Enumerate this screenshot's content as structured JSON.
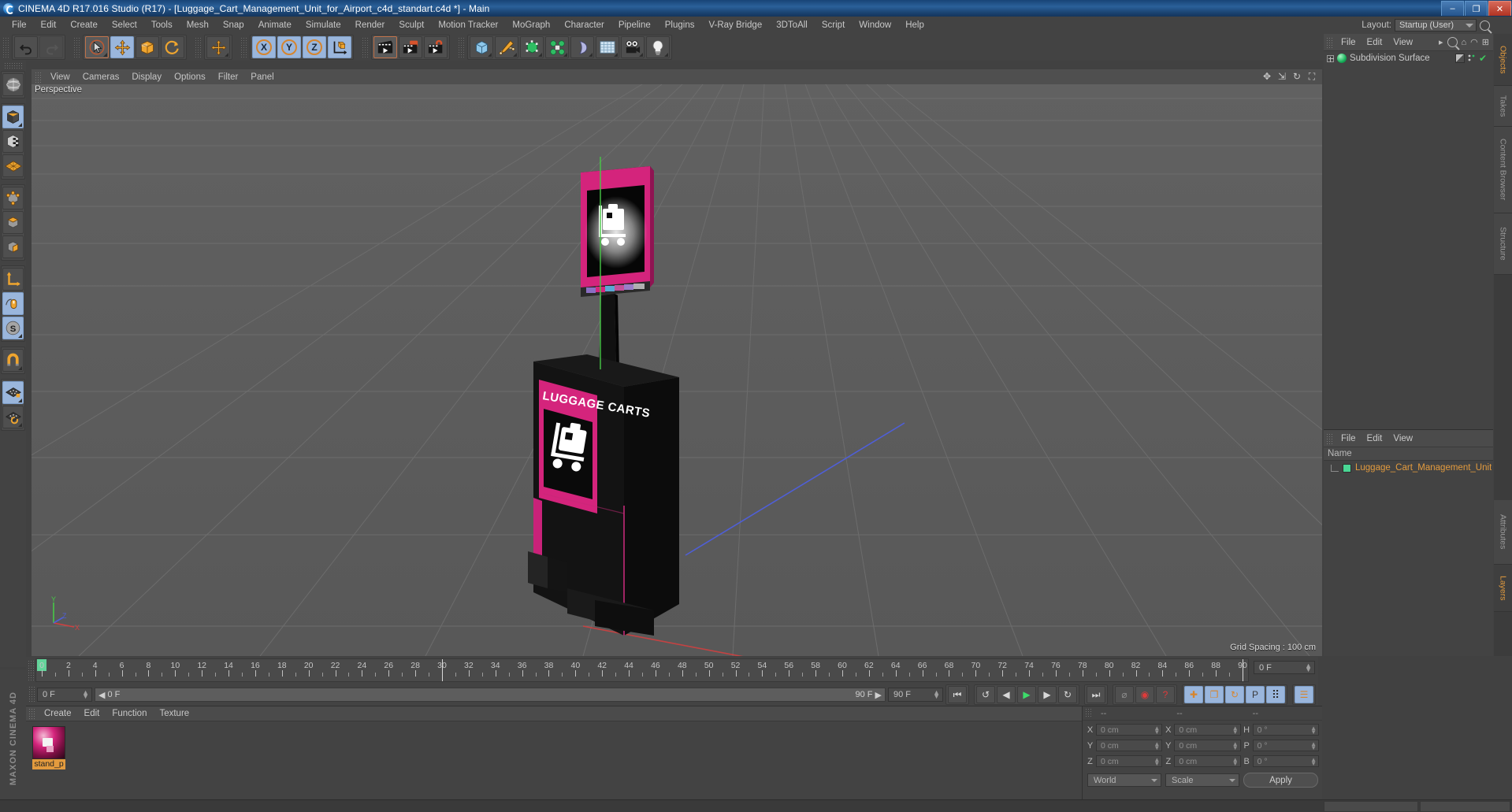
{
  "window": {
    "title": "CINEMA 4D R17.016 Studio (R17) - [Luggage_Cart_Management_Unit_for_Airport_c4d_standart.c4d *] - Main",
    "app_icon": "c4d-logo-icon",
    "minimize": "–",
    "maximize": "❐",
    "close": "✕"
  },
  "menubar": {
    "items": [
      "File",
      "Edit",
      "Create",
      "Select",
      "Tools",
      "Mesh",
      "Snap",
      "Animate",
      "Simulate",
      "Render",
      "Sculpt",
      "Motion Tracker",
      "MoGraph",
      "Character",
      "Pipeline",
      "Plugins",
      "V-Ray Bridge",
      "3DToAll",
      "Script",
      "Window",
      "Help"
    ],
    "layout_label": "Layout:",
    "layout_value": "Startup (User)",
    "search_icon": "search-icon"
  },
  "toolbar": {
    "groups": [
      {
        "name": "history",
        "buttons": [
          {
            "name": "undo-button",
            "glyph": "↶",
            "state": "normal"
          },
          {
            "name": "redo-button",
            "glyph": "↷",
            "state": "disabled"
          }
        ]
      },
      {
        "name": "transform-tools",
        "buttons": [
          {
            "name": "live-selection-tool",
            "glyph": "➤",
            "state": "selected"
          },
          {
            "name": "move-tool",
            "glyph": "✚",
            "state": "active"
          },
          {
            "name": "scale-tool",
            "glyph": "❐",
            "state": "normal"
          },
          {
            "name": "rotate-tool",
            "glyph": "↻",
            "state": "normal"
          }
        ]
      },
      {
        "name": "move-duplicate",
        "buttons": [
          {
            "name": "move-axis-tool",
            "glyph": "✚",
            "state": "normal"
          }
        ]
      },
      {
        "name": "axis-locks",
        "buttons": [
          {
            "name": "x-axis-lock",
            "glyph": "X",
            "state": "active"
          },
          {
            "name": "y-axis-lock",
            "glyph": "Y",
            "state": "active"
          },
          {
            "name": "z-axis-lock",
            "glyph": "Z",
            "state": "active"
          },
          {
            "name": "world-object-coordinates",
            "glyph": "◰",
            "state": "normal"
          }
        ]
      },
      {
        "name": "render-group",
        "buttons": [
          {
            "name": "render-view-button",
            "glyph": "▶",
            "state": "selected"
          },
          {
            "name": "render-to-picture-viewer-button",
            "glyph": "▶",
            "state": "normal"
          },
          {
            "name": "render-settings-button",
            "glyph": "⚙",
            "state": "normal"
          }
        ]
      },
      {
        "name": "object-group",
        "buttons": [
          {
            "name": "cube-primitive-button",
            "glyph": "■",
            "state": "normal"
          },
          {
            "name": "spline-pen-button",
            "glyph": "✎",
            "state": "normal"
          },
          {
            "name": "generator-button",
            "glyph": "▣",
            "state": "normal"
          },
          {
            "name": "mograph-button",
            "glyph": "⁂",
            "state": "normal"
          },
          {
            "name": "deformer-button",
            "glyph": "◖",
            "state": "normal"
          },
          {
            "name": "environment-button",
            "glyph": "▦",
            "state": "normal"
          },
          {
            "name": "camera-button",
            "glyph": "■",
            "state": "normal"
          },
          {
            "name": "light-button",
            "glyph": "●",
            "state": "normal"
          }
        ]
      }
    ]
  },
  "left_toolbar": {
    "buttons": [
      {
        "name": "make-editable-button",
        "glyph": "◎",
        "state": "normal"
      },
      {
        "name": "model-mode-button",
        "glyph": "⬛",
        "state": "active"
      },
      {
        "name": "texture-mode-button",
        "glyph": "▦",
        "state": "normal"
      },
      {
        "name": "workplane-mode-button",
        "glyph": "◆",
        "state": "normal"
      },
      {
        "name": "points-mode-button",
        "glyph": "●",
        "state": "normal"
      },
      {
        "name": "edges-mode-button",
        "glyph": "▭",
        "state": "normal"
      },
      {
        "name": "polygons-mode-button",
        "glyph": "▰",
        "state": "normal"
      },
      {
        "name": "axis-mode-button",
        "glyph": "∟",
        "state": "normal"
      },
      {
        "name": "enable-snapping-button",
        "glyph": "Ὓ1",
        "state": "active"
      },
      {
        "name": "soft-selection-button",
        "glyph": "S",
        "state": "active"
      },
      {
        "name": "magnet-tool-button",
        "glyph": "∪",
        "state": "normal"
      },
      {
        "name": "lock-workplane-button",
        "glyph": "▦",
        "state": "active"
      },
      {
        "name": "planar-workplane-button",
        "glyph": "▦",
        "state": "normal"
      }
    ],
    "brand": "MAXON CINEMA 4D"
  },
  "viewport": {
    "menu": [
      "View",
      "Cameras",
      "Display",
      "Options",
      "Filter",
      "Panel"
    ],
    "label": "Perspective",
    "grid_info": "Grid Spacing : 100 cm",
    "nav_icons": [
      "move-view-icon",
      "scale-view-icon",
      "rotate-view-icon",
      "maximize-view-icon"
    ],
    "axis_labels": {
      "x": "X",
      "y": "Y",
      "z": "Z"
    },
    "model": {
      "sign_text": "LUGGAGE CARTS",
      "luggage_icon": "suitcase-trolley-icon",
      "accent_color": "#d4247c",
      "body_color": "#1b1b1b"
    }
  },
  "object_manager": {
    "menu": [
      "File",
      "Edit",
      "View"
    ],
    "overflow_icon": "chevron-right-icon",
    "toolbar_icons": [
      "search-icon",
      "home-icon",
      "eye-icon",
      "layout-icon"
    ],
    "rows": [
      {
        "name": "Subdivision Surface",
        "icon": "subdivision-surface-icon",
        "tags": [
          "material-tag",
          "dots-tag",
          "check-tag"
        ]
      }
    ]
  },
  "layer_manager": {
    "menu": [
      "File",
      "Edit",
      "View"
    ],
    "column_header": "Name",
    "rows": [
      {
        "name": "Luggage_Cart_Management_Unit",
        "color": "#49d694"
      }
    ]
  },
  "right_tabs": {
    "top": [
      "Objects",
      "Takes",
      "Content Browser",
      "Structure"
    ],
    "bottom": [
      "Attributes",
      "Layers"
    ],
    "active_top": "Objects",
    "active_bottom": "Layers"
  },
  "timeline": {
    "ticks": [
      0,
      2,
      4,
      6,
      8,
      10,
      12,
      14,
      16,
      18,
      20,
      22,
      24,
      26,
      28,
      30,
      32,
      34,
      36,
      38,
      40,
      42,
      44,
      46,
      48,
      50,
      52,
      54,
      56,
      58,
      60,
      62,
      64,
      66,
      68,
      70,
      72,
      74,
      76,
      78,
      80,
      82,
      84,
      86,
      88,
      90
    ],
    "min_frame": 0,
    "max_frame": 90,
    "current_frame_field": "0 F",
    "playhead_frame": 0
  },
  "transport": {
    "start_field": "0 F",
    "range_left": "0 F",
    "range_right": "90 F",
    "end_field": "90 F",
    "buttons": [
      {
        "name": "go-to-start-button",
        "glyph": "⏮"
      },
      {
        "name": "previous-keyframe-button",
        "glyph": "↺"
      },
      {
        "name": "step-back-button",
        "glyph": "◀"
      },
      {
        "name": "play-button",
        "glyph": "▶"
      },
      {
        "name": "step-forward-button",
        "glyph": "▶"
      },
      {
        "name": "next-keyframe-button",
        "glyph": "↻"
      },
      {
        "name": "go-to-end-button",
        "glyph": "⏭"
      }
    ],
    "record_buttons": [
      {
        "name": "autokeying-button",
        "glyph": "⌀"
      },
      {
        "name": "record-active-objects-button",
        "glyph": "◉"
      },
      {
        "name": "keyframe-selection-button",
        "glyph": "?"
      }
    ],
    "key_filters": [
      {
        "name": "position-key-button",
        "glyph": "✚",
        "state": "active"
      },
      {
        "name": "scale-key-button",
        "glyph": "❐",
        "state": "active"
      },
      {
        "name": "rotation-key-button",
        "glyph": "↻",
        "state": "active"
      },
      {
        "name": "parameter-key-button",
        "glyph": "P",
        "state": "active"
      },
      {
        "name": "point-level-animation-button",
        "glyph": "⠿",
        "state": "active"
      }
    ],
    "extra_button": {
      "name": "timeline-toggle-button",
      "glyph": "☰",
      "state": "active"
    }
  },
  "material_manager": {
    "menu": [
      "Create",
      "Edit",
      "Function",
      "Texture"
    ],
    "materials": [
      {
        "name": "stand_p",
        "icon": "material-sphere-icon",
        "color": "#d4247c"
      }
    ]
  },
  "coordinates": {
    "headers": [
      "--",
      "--",
      "--"
    ],
    "position": {
      "label_x": "X",
      "label_y": "Y",
      "label_z": "Z",
      "x": "0 cm",
      "y": "0 cm",
      "z": "0 cm"
    },
    "size": {
      "label_x": "X",
      "label_y": "Y",
      "label_z": "Z",
      "x": "0 cm",
      "y": "0 cm",
      "z": "0 cm"
    },
    "rotation": {
      "label_h": "H",
      "label_p": "P",
      "label_b": "B",
      "h": "0 °",
      "p": "0 °",
      "b": "0 °"
    },
    "system": "World",
    "mode": "Scale",
    "apply": "Apply"
  }
}
